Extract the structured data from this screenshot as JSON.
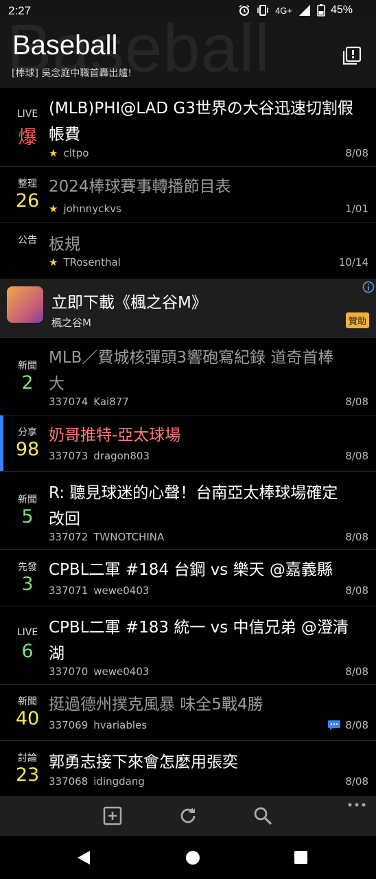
{
  "status_bar": {
    "time": "2:27",
    "network": "4G+",
    "battery": "45%"
  },
  "header": {
    "title": "Baseball",
    "watermark": "Baseball",
    "subtitle": "[棒球] 吳念庭中職首轟出爐!"
  },
  "posts": [
    {
      "tag": "LIVE",
      "num": "爆",
      "num_color": "#ff5a5a",
      "title": "(MLB)PHI@LAD G3世界の大谷迅速切割假帳費",
      "title_line1": "(MLB)PHI@LAD G3世界の大谷迅速切割假",
      "title_line2": "帳費",
      "title_color": "#ffffff",
      "id": "",
      "author": "citpo",
      "starred": true,
      "date": "8/08"
    },
    {
      "tag": "整理",
      "num": "26",
      "num_color": "#f7e75a",
      "title": "2024棒球賽事轉播節目表",
      "title_color": "#9a9a9a",
      "id": "",
      "author": "johnnyckvs",
      "starred": true,
      "date": "1/01"
    },
    {
      "tag": "公告",
      "num": "",
      "num_color": "#ffffff",
      "title": "板規",
      "title_color": "#9a9a9a",
      "id": "",
      "author": "TRosenthal",
      "starred": true,
      "date": "10/14"
    }
  ],
  "ad": {
    "title": "立即下載《楓之谷M》",
    "sponsor": "楓之谷M",
    "badge": "贊助"
  },
  "posts2": [
    {
      "tag": "新聞",
      "num": "2",
      "num_color": "#7ee07e",
      "title_line1": "MLB／費城核彈頭3響砲寫紀錄 道奇首棒",
      "title_line2": "大",
      "title_color": "#9a9a9a",
      "id": "337074",
      "author": "Kai877",
      "date": "8/08"
    },
    {
      "tag": "分享",
      "num": "98",
      "num_color": "#f7e75a",
      "title": "奶哥推特-亞太球場",
      "title_color": "#ff7a7a",
      "id": "337073",
      "author": "dragon803",
      "date": "8/08"
    },
    {
      "tag": "新聞",
      "num": "5",
      "num_color": "#7ee07e",
      "title_line1": "R: 聽見球迷的心聲！台南亞太棒球場確定",
      "title_line2": "改回",
      "title_color": "#ffffff",
      "id": "337072",
      "author": "TWNOTCHINA",
      "date": "8/08"
    },
    {
      "tag": "先發",
      "num": "3",
      "num_color": "#7ee07e",
      "title": "CPBL二軍 #184 台鋼 vs 樂天 @嘉義縣",
      "title_color": "#ffffff",
      "id": "337071",
      "author": "wewe0403",
      "date": "8/08"
    },
    {
      "tag": "LIVE",
      "num": "6",
      "num_color": "#7ee07e",
      "title_line1": "CPBL二軍 #183 統一 vs 中信兄弟 @澄清",
      "title_line2": "湖",
      "title_color": "#ffffff",
      "id": "337070",
      "author": "wewe0403",
      "date": "8/08"
    },
    {
      "tag": "新聞",
      "num": "40",
      "num_color": "#f7e75a",
      "title": "挺過德州撲克風暴 味全5戰4勝",
      "title_color": "#9a9a9a",
      "id": "337069",
      "author": "hvariables",
      "date": "8/08"
    },
    {
      "tag": "討論",
      "num": "23",
      "num_color": "#f7e75a",
      "title": "郭勇志接下來會怎麼用張奕",
      "title_color": "#ffffff",
      "id": "337068",
      "author": "idingdang",
      "date": "8/08"
    }
  ],
  "icons": {
    "header_action": "board-info-icon",
    "ad_info": "info-icon",
    "comment": "comment-icon",
    "toolbar": [
      "new-post-icon",
      "refresh-icon",
      "search-icon",
      "more-icon"
    ],
    "navbar": [
      "back-icon",
      "home-icon",
      "recents-icon"
    ]
  }
}
